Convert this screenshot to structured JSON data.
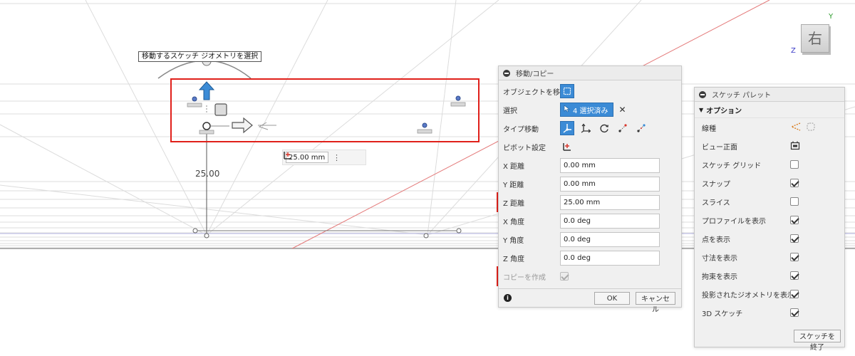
{
  "canvas": {
    "tooltip": "移動するスケッチ ジオメトリを選択",
    "dimension_label": "25.00",
    "distance_input": "25.00 mm"
  },
  "viewcube": {
    "face_label": "右",
    "axis_y": "Y",
    "axis_z": "Z"
  },
  "move_copy": {
    "title": "移動/コピー",
    "rows": {
      "object_label": "オブジェクトを移動",
      "select_label": "選択",
      "selected_chip": "4 選択済み",
      "type_label": "タイプ移動",
      "pivot_label": "ピボット設定",
      "x_dist_label": "X 距離",
      "x_dist_value": "0.00 mm",
      "y_dist_label": "Y 距離",
      "y_dist_value": "0.00 mm",
      "z_dist_label": "Z 距離",
      "z_dist_value": "25.00 mm",
      "x_angle_label": "X 角度",
      "x_angle_value": "0.0 deg",
      "y_angle_label": "Y 角度",
      "y_angle_value": "0.0 deg",
      "z_angle_label": "Z 角度",
      "z_angle_value": "0.0 deg",
      "copy_label": "コピーを作成",
      "copy_checked": true
    },
    "ok_label": "OK",
    "cancel_label": "キャンセル"
  },
  "sketch_palette": {
    "title": "スケッチ パレット",
    "section": "オプション",
    "rows": [
      {
        "label": "線種",
        "control": "icons"
      },
      {
        "label": "ビュー正面",
        "control": "icon"
      },
      {
        "label": "スケッチ グリッド",
        "control": "checkbox",
        "checked": false
      },
      {
        "label": "スナップ",
        "control": "checkbox",
        "checked": true
      },
      {
        "label": "スライス",
        "control": "checkbox",
        "checked": false
      },
      {
        "label": "プロファイルを表示",
        "control": "checkbox",
        "checked": true
      },
      {
        "label": "点を表示",
        "control": "checkbox",
        "checked": true
      },
      {
        "label": "寸法を表示",
        "control": "checkbox",
        "checked": true
      },
      {
        "label": "拘束を表示",
        "control": "checkbox",
        "checked": true
      },
      {
        "label": "投影されたジオメトリを表示",
        "control": "checkbox",
        "checked": true
      },
      {
        "label": "3D スケッチ",
        "control": "checkbox",
        "checked": true
      }
    ],
    "finish_label": "スケッチを終了"
  },
  "colors": {
    "highlight_red": "#e0201a",
    "accent_blue": "#3b8bd6"
  }
}
